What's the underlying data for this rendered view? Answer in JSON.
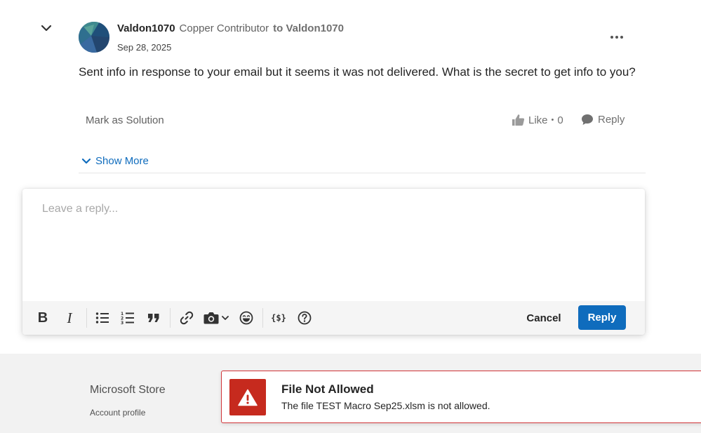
{
  "post": {
    "author": "Valdon1070",
    "rank": "Copper Contributor",
    "to_user": "to Valdon1070",
    "date": "Sep 28, 2025",
    "body": "Sent info in response to your email but it seems it was not delivered. What is the secret to get info to you?",
    "mark_solution_label": "Mark as Solution",
    "like_label": "Like",
    "like_separator": "•",
    "like_count": "0",
    "reply_label": "Reply",
    "show_more_label": "Show More",
    "icons": {
      "collapse": "chevron-down-icon",
      "more": "more-horizontal-icon",
      "like": "thumbs-up-icon",
      "reply": "speech-bubble-icon",
      "show_more": "chevron-down-icon"
    }
  },
  "editor": {
    "placeholder": "Leave a reply...",
    "value": "",
    "toolbar": [
      {
        "name": "bold",
        "icon": "bold-icon"
      },
      {
        "name": "italic",
        "icon": "italic-icon"
      },
      {
        "name": "bulleted-list",
        "icon": "bulleted-list-icon"
      },
      {
        "name": "numbered-list",
        "icon": "numbered-list-icon"
      },
      {
        "name": "quote",
        "icon": "quote-icon"
      },
      {
        "name": "link",
        "icon": "link-icon"
      },
      {
        "name": "insert-image",
        "icon": "camera-icon"
      },
      {
        "name": "emoji",
        "icon": "smiley-icon"
      },
      {
        "name": "code-snippet",
        "icon": "code-braces-icon"
      },
      {
        "name": "help",
        "icon": "help-circle-icon"
      }
    ],
    "bold_glyph": "B",
    "italic_glyph": "I",
    "code_glyph": "{$}",
    "cancel_label": "Cancel",
    "submit_label": "Reply"
  },
  "footer": {
    "heading": "Microsoft Store",
    "link": "Account profile"
  },
  "toast": {
    "title": "File Not Allowed",
    "message": "The file TEST Macro Sep25.xlsm is not allowed.",
    "icon": "warning-icon"
  },
  "colors": {
    "accent": "#0f6cbd",
    "error": "#c62a1e",
    "error_border": "#d13438",
    "footer_bg": "#f2f2f2"
  }
}
